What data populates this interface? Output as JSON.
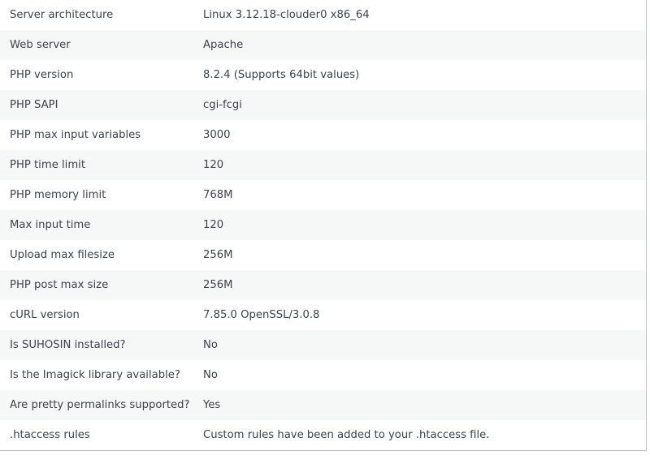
{
  "rows": [
    {
      "label": "Server architecture",
      "value": "Linux 3.12.18-clouder0 x86_64"
    },
    {
      "label": "Web server",
      "value": "Apache"
    },
    {
      "label": "PHP version",
      "value": "8.2.4 (Supports 64bit values)"
    },
    {
      "label": "PHP SAPI",
      "value": "cgi-fcgi"
    },
    {
      "label": "PHP max input variables",
      "value": "3000"
    },
    {
      "label": "PHP time limit",
      "value": "120"
    },
    {
      "label": "PHP memory limit",
      "value": "768M"
    },
    {
      "label": "Max input time",
      "value": "120"
    },
    {
      "label": "Upload max filesize",
      "value": "256M"
    },
    {
      "label": "PHP post max size",
      "value": "256M"
    },
    {
      "label": "cURL version",
      "value": "7.85.0 OpenSSL/3.0.8"
    },
    {
      "label": "Is SUHOSIN installed?",
      "value": "No"
    },
    {
      "label": "Is the Imagick library available?",
      "value": "No"
    },
    {
      "label": "Are pretty permalinks supported?",
      "value": "Yes"
    },
    {
      "label": ".htaccess rules",
      "value": "Custom rules have been added to your .htaccess file."
    }
  ]
}
